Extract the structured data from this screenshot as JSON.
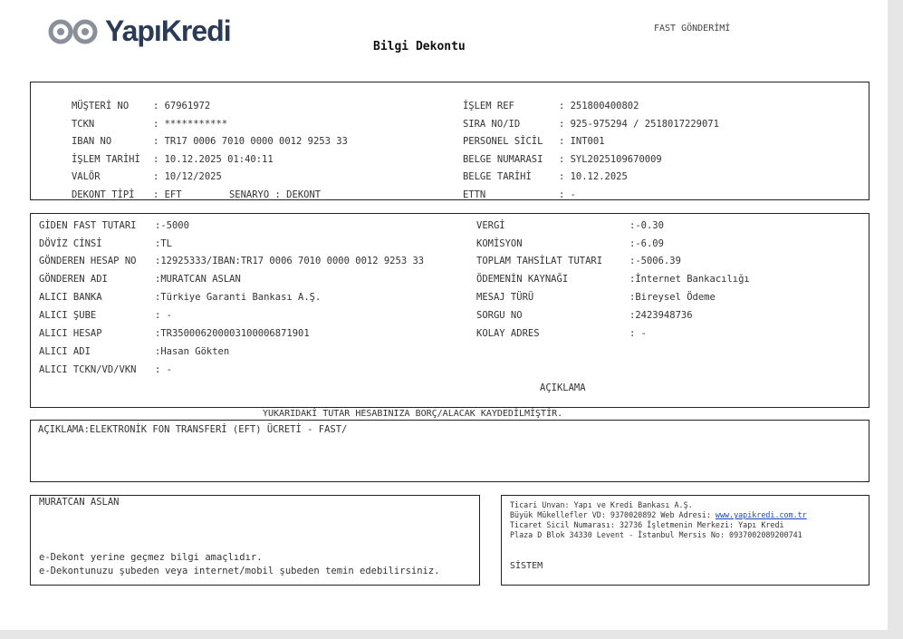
{
  "header": {
    "brand": "YapıKredi",
    "title": "Bilgi Dekontu",
    "type": "FAST GÖNDERİMİ",
    "logo_color": "#2b3a55"
  },
  "info_left": [
    {
      "label": "MÜŞTERİ NO",
      "value": ": 67961972"
    },
    {
      "label": "TCKN",
      "value": ": ***********"
    },
    {
      "label": "IBAN NO",
      "value": ": TR17 0006 7010 0000 0012 9253 33"
    },
    {
      "label": "İŞLEM TARİHİ",
      "value": ": 10.12.2025 01:40:11"
    },
    {
      "label": "VALÖR",
      "value": ": 10/12/2025"
    },
    {
      "label": "DEKONT TİPİ",
      "value": ": EFT"
    }
  ],
  "scenario": {
    "label": "SENARYO",
    "value": ": DEKONT"
  },
  "info_right": [
    {
      "label": "İŞLEM REF",
      "value": ": 251800400802"
    },
    {
      "label": "SIRA NO/ID",
      "value": ": 925-975294 / 2518017229071"
    },
    {
      "label": "PERSONEL SİCİL",
      "value": ": INT001"
    },
    {
      "label": "BELGE NUMARASI",
      "value": ": SYL2025109670009"
    },
    {
      "label": "BELGE TARİHİ",
      "value": ": 10.12.2025"
    },
    {
      "label": "ETTN",
      "value": ": -"
    }
  ],
  "details_left": [
    {
      "label": "GİDEN FAST TUTARI",
      "value": ":-5000"
    },
    {
      "label": "DÖVİZ CİNSİ",
      "value": ":TL"
    },
    {
      "label": "GÖNDEREN HESAP NO",
      "value": ":12925333/IBAN:TR17 0006 7010 0000 0012 9253 33"
    },
    {
      "label": "GÖNDEREN ADI",
      "value": ":MURATCAN ASLAN"
    },
    {
      "label": "ALICI BANKA",
      "value": ":Türkiye Garanti Bankası A.Ş."
    },
    {
      "label": "ALICI ŞUBE",
      "value": ": -"
    },
    {
      "label": "ALICI HESAP",
      "value": ":TR350006200003100006871901"
    },
    {
      "label": "ALICI ADI",
      "value": ":Hasan Gökten"
    },
    {
      "label": "ALICI TCKN/VD/VKN",
      "value": ": -"
    }
  ],
  "details_right": [
    {
      "label": "VERGİ",
      "value": ":-0.30"
    },
    {
      "label": "KOMİSYON",
      "value": ":-6.09"
    },
    {
      "label": "TOPLAM TAHSİLAT TUTARI",
      "value": ":-5006.39"
    },
    {
      "label": "ÖDEMENİN KAYNAĞI",
      "value": ":İnternet Bankacılığı"
    },
    {
      "label": "MESAJ TÜRÜ",
      "value": ":Bireysel Ödeme"
    },
    {
      "label": "SORGU NO",
      "value": ":2423948736"
    },
    {
      "label": "KOLAY ADRES",
      "value": ": -"
    }
  ],
  "aciklama_heading": "AÇIKLAMA",
  "debit_note": "YUKARIDAKİ TUTAR HESABINIZA BORÇ/ALACAK KAYDEDİLMİŞTİR.",
  "description": "AÇIKLAMA:ELEKTRONİK FON TRANSFERİ (EFT) ÜCRETİ - FAST/",
  "customer_name": "MURATCAN ASLAN",
  "disclaimer_1": "e-Dekont yerine geçmez bilgi amaçlıdır.",
  "disclaimer_2": "e-Dekontunuzu şubeden veya internet/mobil şubeden temin edebilirsiniz.",
  "company": {
    "line1": "Ticari Unvan: Yapı ve Kredi Bankası A.Ş.",
    "line2_prefix": "Büyük Mükellefler VD: 9370020892 Web Adresi: ",
    "web": "www.yapikredi.com.tr",
    "line3": "Ticaret Sicil Numarası: 32736 İşletmenin Merkezi: Yapı Kredi",
    "line4": "Plaza D Blok 34330 Levent - İstanbul Mersis No: 0937002089200741",
    "system": "SİSTEM"
  }
}
